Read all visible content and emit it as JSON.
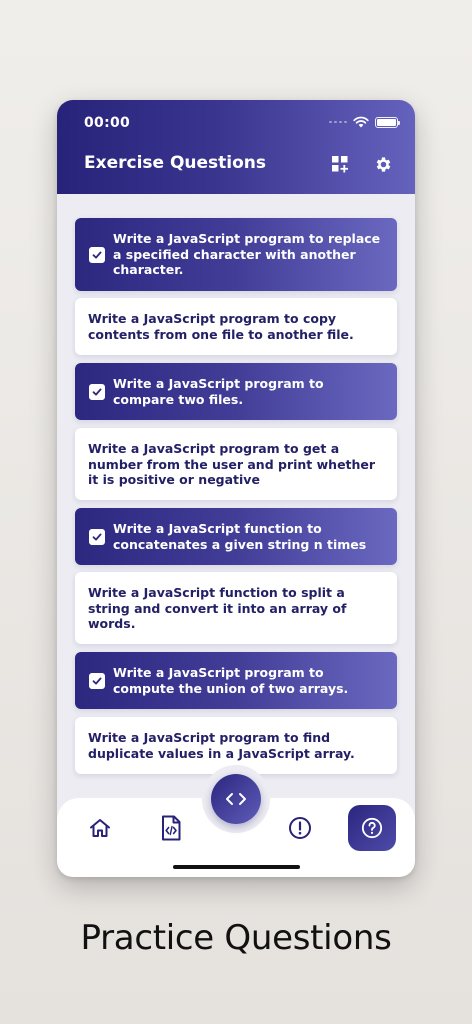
{
  "status_bar": {
    "time": "00:00"
  },
  "header": {
    "title": "Exercise Questions"
  },
  "questions": [
    {
      "text": "Write a JavaScript program to replace a specified character with another character.",
      "completed": true
    },
    {
      "text": "Write a JavaScript program to copy contents from one file to another file.",
      "completed": false
    },
    {
      "text": "Write a JavaScript program to compare two files.",
      "completed": true
    },
    {
      "text": "Write a JavaScript program to get a number from the user and print whether it is positive or negative",
      "completed": false
    },
    {
      "text": "Write a JavaScript function to concatenates a given string n times",
      "completed": true
    },
    {
      "text": "Write a JavaScript function to split a string and convert it into an array of words.",
      "completed": false
    },
    {
      "text": "Write a JavaScript program to compute the union of two arrays.",
      "completed": true
    },
    {
      "text": "Write a JavaScript program to find duplicate values in a JavaScript array.",
      "completed": false
    }
  ],
  "bottom_nav": {
    "items": [
      {
        "icon": "home-icon"
      },
      {
        "icon": "code-file-icon"
      },
      {
        "icon": "code-brackets-icon"
      },
      {
        "icon": "alert-icon"
      },
      {
        "icon": "help-icon",
        "active": true
      }
    ]
  },
  "caption": "Practice Questions",
  "colors": {
    "primary_dark": "#27237a",
    "primary_light": "#6562bd",
    "card_text": "#242066"
  }
}
